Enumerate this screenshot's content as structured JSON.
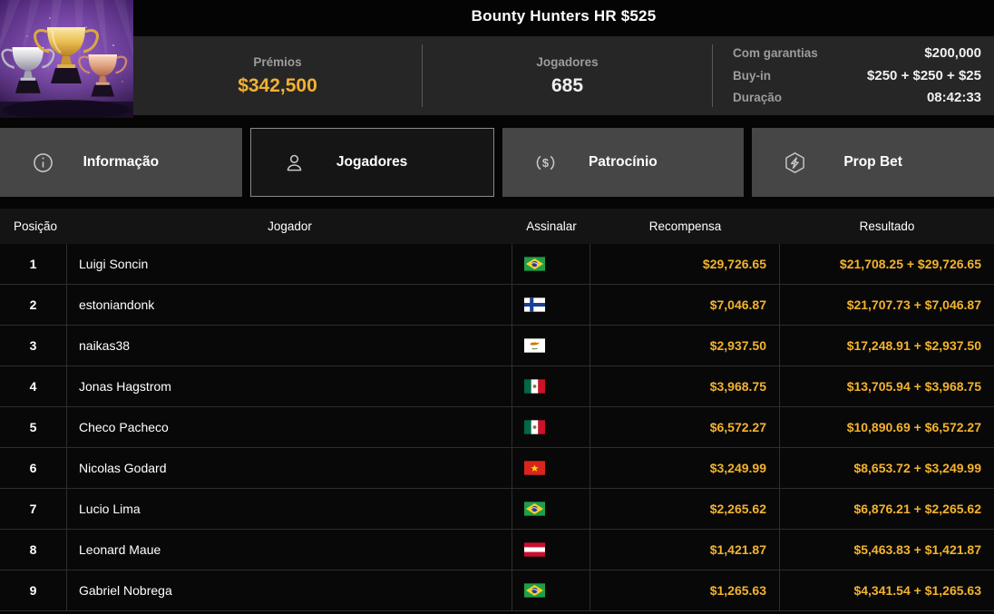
{
  "header": {
    "title": "Bounty Hunters HR $525",
    "prizes_label": "Prémios",
    "prizes_value": "$342,500",
    "players_label": "Jogadores",
    "players_value": "685",
    "details": [
      {
        "label": "Com garantias",
        "value": "$200,000"
      },
      {
        "label": "Buy-in",
        "value": "$250 + $250 + $25"
      },
      {
        "label": "Duração",
        "value": "08:42:33"
      }
    ]
  },
  "tabs": [
    {
      "label": "Informação",
      "icon": "info-icon",
      "active": false
    },
    {
      "label": "Jogadores",
      "icon": "players-icon",
      "active": true
    },
    {
      "label": "Patrocínio",
      "icon": "sponsor-dollar-icon",
      "active": false
    },
    {
      "label": "Prop Bet",
      "icon": "prop-bet-hexagon-icon",
      "active": false
    }
  ],
  "table": {
    "columns": [
      "Posição",
      "Jogador",
      "Assinalar",
      "Recompensa",
      "Resultado"
    ],
    "rows": [
      {
        "position": "1",
        "player": "Luigi Soncin",
        "flag": "flag-brazil-icon",
        "reward": "$29,726.65",
        "result": "$21,708.25 + $29,726.65"
      },
      {
        "position": "2",
        "player": "estoniandonk",
        "flag": "flag-finland-icon",
        "reward": "$7,046.87",
        "result": "$21,707.73 + $7,046.87"
      },
      {
        "position": "3",
        "player": "naikas38",
        "flag": "flag-cyprus-icon",
        "reward": "$2,937.50",
        "result": "$17,248.91 + $2,937.50"
      },
      {
        "position": "4",
        "player": "Jonas Hagstrom",
        "flag": "flag-mexico-icon",
        "reward": "$3,968.75",
        "result": "$13,705.94 + $3,968.75"
      },
      {
        "position": "5",
        "player": "Checo Pacheco",
        "flag": "flag-mexico-icon",
        "reward": "$6,572.27",
        "result": "$10,890.69 + $6,572.27"
      },
      {
        "position": "6",
        "player": "Nicolas Godard",
        "flag": "flag-vietnam-icon",
        "reward": "$3,249.99",
        "result": "$8,653.72 + $3,249.99"
      },
      {
        "position": "7",
        "player": "Lucio Lima",
        "flag": "flag-brazil-icon",
        "reward": "$2,265.62",
        "result": "$6,876.21 + $2,265.62"
      },
      {
        "position": "8",
        "player": "Leonard Maue",
        "flag": "flag-austria-icon",
        "reward": "$1,421.87",
        "result": "$5,463.83 + $1,421.87"
      },
      {
        "position": "9",
        "player": "Gabriel Nobrega",
        "flag": "flag-brazil-icon",
        "reward": "$1,265.63",
        "result": "$4,341.54 + $1,265.63"
      }
    ]
  },
  "colors": {
    "accent_gold": "#f2b230",
    "amount_gold": "#f3b32e",
    "panel_bg": "#262626",
    "tab_inactive_bg": "#464646",
    "tab_active_bg": "#151515",
    "table_header_bg": "#141414",
    "row_bg": "#080808",
    "label_gray": "#9c9c9c"
  }
}
